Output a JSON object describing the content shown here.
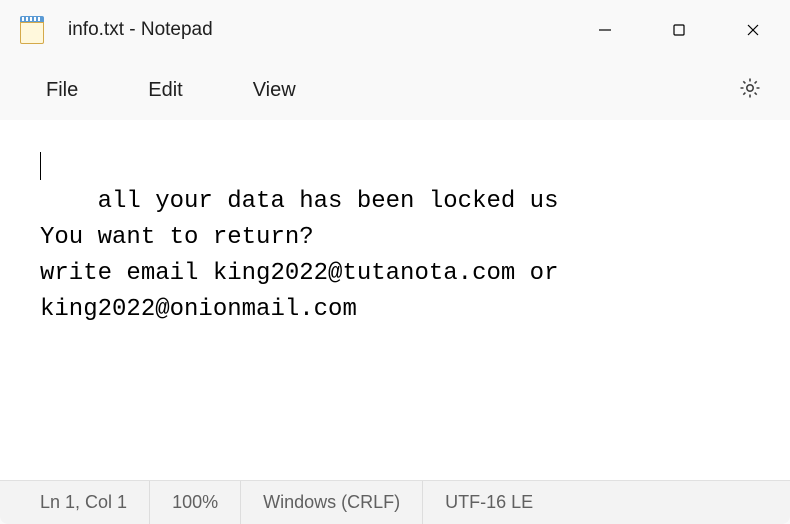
{
  "window": {
    "title": "info.txt - Notepad"
  },
  "menu": {
    "file": "File",
    "edit": "Edit",
    "view": "View"
  },
  "content": {
    "text": "all your data has been locked us\nYou want to return?\nwrite email king2022@tutanota.com or king2022@onionmail.com"
  },
  "status": {
    "position": "Ln 1, Col 1",
    "zoom": "100%",
    "line_ending": "Windows (CRLF)",
    "encoding": "UTF-16 LE"
  }
}
